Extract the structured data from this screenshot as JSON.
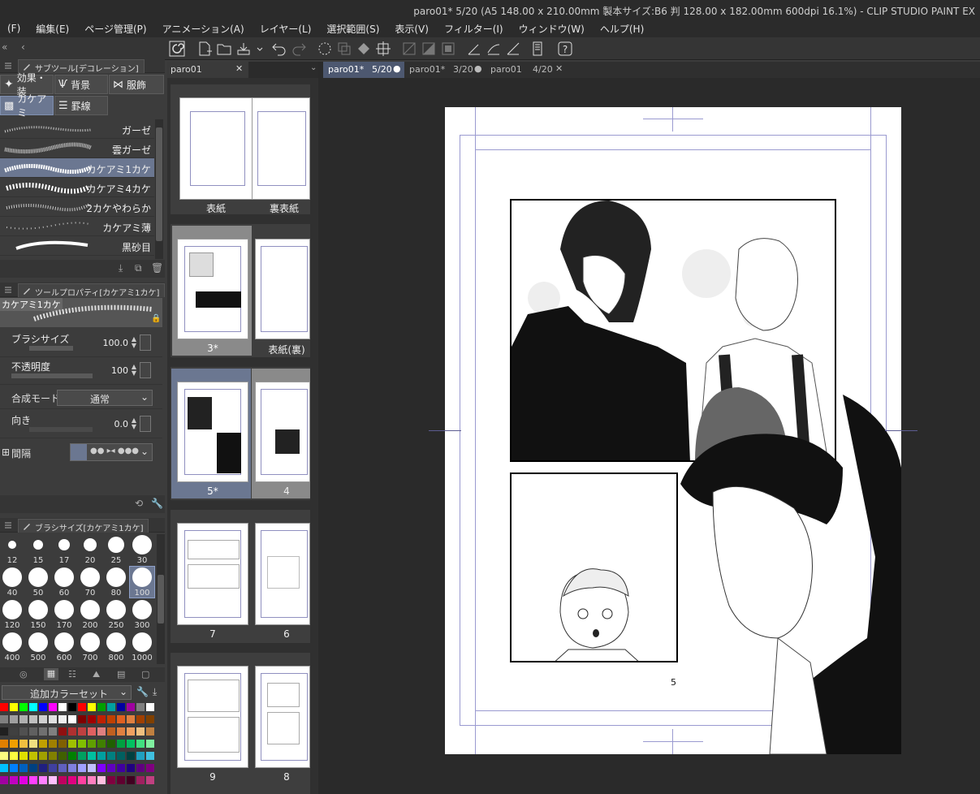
{
  "window": {
    "title": "paro01* 5/20 (A5 148.00 x 210.00mm 製本サイズ:B6 判 128.00 x 182.00mm 600dpi 16.1%)  - CLIP STUDIO PAINT EX"
  },
  "menu": [
    "(F)",
    "編集(E)",
    "ページ管理(P)",
    "アニメーション(A)",
    "レイヤー(L)",
    "選択範囲(S)",
    "表示(V)",
    "フィルター(I)",
    "ウィンドウ(W)",
    "ヘルプ(H)"
  ],
  "subtool": {
    "header": "サブツール[デコレーション]",
    "categories": [
      {
        "label": "効果・装",
        "icon": "sparkle-icon"
      },
      {
        "label": "背景",
        "icon": "grass-icon"
      },
      {
        "label": "服飾",
        "icon": "ribbon-icon"
      },
      {
        "label": "カケアミ",
        "icon": "crosshatch-icon"
      },
      {
        "label": "罫線",
        "icon": "lines-icon"
      }
    ],
    "brushes": [
      {
        "label": "ガーゼ"
      },
      {
        "label": "雲ガーゼ"
      },
      {
        "label": "カケアミ1カケ"
      },
      {
        "label": "カケアミ4カケ"
      },
      {
        "label": "2カケやわらか"
      },
      {
        "label": "カケアミ薄"
      },
      {
        "label": "黒砂目"
      }
    ]
  },
  "toolprop": {
    "header": "ツールプロパティ[カケアミ1カケ]",
    "preview_label": "カケアミ1カケ",
    "brush_size": {
      "label": "ブラシサイズ",
      "value": "100.0"
    },
    "opacity": {
      "label": "不透明度",
      "value": "100"
    },
    "blend": {
      "label": "合成モード",
      "value": "通常"
    },
    "direction": {
      "label": "向き",
      "value": "0.0"
    },
    "spacing": {
      "label": "間隔"
    }
  },
  "brushsize": {
    "header": "ブラシサイズ[カケアミ1カケ]",
    "sizes": [
      "12",
      "15",
      "17",
      "20",
      "25",
      "30",
      "40",
      "50",
      "60",
      "70",
      "80",
      "100",
      "120",
      "150",
      "170",
      "200",
      "250",
      "300",
      "400",
      "500",
      "600",
      "700",
      "800",
      "1000"
    ]
  },
  "colorset": {
    "name": "追加カラーセット"
  },
  "pages": {
    "tab": "paro01",
    "items": [
      {
        "label": "表紙"
      },
      {
        "label": "裏表紙"
      },
      {
        "label": "3*"
      },
      {
        "label": "表紙(裏)"
      },
      {
        "label": "5*"
      },
      {
        "label": "4"
      },
      {
        "label": "7"
      },
      {
        "label": "6"
      },
      {
        "label": "9"
      },
      {
        "label": "8"
      }
    ]
  },
  "canvas_tabs": [
    {
      "name": "paro01*",
      "page": "5/20"
    },
    {
      "name": "paro01*",
      "page": "3/20"
    },
    {
      "name": "paro01",
      "page": "4/20"
    }
  ],
  "page_number": "5"
}
